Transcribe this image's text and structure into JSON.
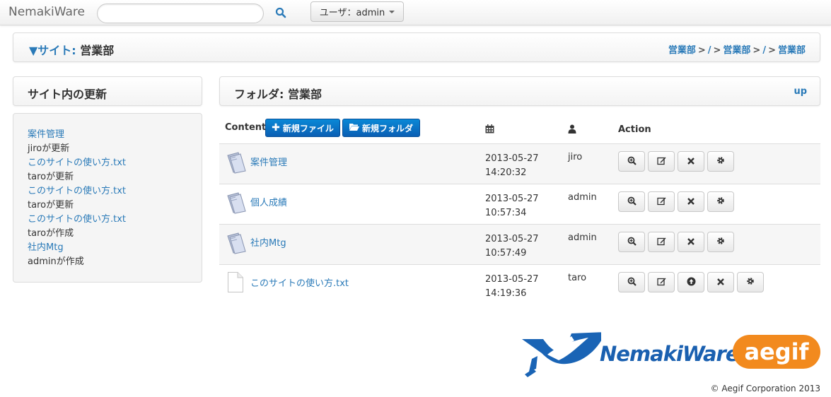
{
  "navbar": {
    "brand": "NemakiWare",
    "search_placeholder": "",
    "user_label": "ユーザ：admin"
  },
  "site": {
    "title_label": "▼サイト:",
    "title_name": "営業部",
    "breadcrumb": [
      "営業部",
      "/",
      "営業部",
      "/",
      "営業部"
    ]
  },
  "sidebar": {
    "title": "サイト内の更新",
    "updates": [
      {
        "text": "案件管理",
        "link": true
      },
      {
        "text": "jiroが更新",
        "link": false
      },
      {
        "text": "このサイトの使い方.txt",
        "link": true
      },
      {
        "text": "taroが更新",
        "link": false
      },
      {
        "text": "このサイトの使い方.txt",
        "link": true
      },
      {
        "text": "taroが更新",
        "link": false
      },
      {
        "text": "このサイトの使い方.txt",
        "link": true
      },
      {
        "text": "taroが作成",
        "link": false
      },
      {
        "text": "社内Mtg",
        "link": true
      },
      {
        "text": "adminが作成",
        "link": false
      }
    ]
  },
  "folder": {
    "title": "フォルダ: 営業部",
    "up_label": "up",
    "content_label": "Content",
    "new_file_label": "新規ファイル",
    "new_folder_label": "新規フォルダ",
    "action_label": "Action",
    "rows": [
      {
        "name": "案件管理",
        "type": "folder",
        "date": "2013-05-27",
        "time": "14:20:32",
        "user": "jiro",
        "actions": [
          "zoom-icon",
          "edit-icon",
          "delete-icon",
          "settings-icon"
        ]
      },
      {
        "name": "個人成績",
        "type": "folder",
        "date": "2013-05-27",
        "time": "10:57:34",
        "user": "admin",
        "actions": [
          "zoom-icon",
          "edit-icon",
          "delete-icon",
          "settings-icon"
        ]
      },
      {
        "name": "社内Mtg",
        "type": "folder",
        "date": "2013-05-27",
        "time": "10:57:49",
        "user": "admin",
        "actions": [
          "zoom-icon",
          "edit-icon",
          "delete-icon",
          "settings-icon"
        ]
      },
      {
        "name": "このサイトの使い方.txt",
        "type": "file",
        "date": "2013-05-27",
        "time": "14:19:36",
        "user": "taro",
        "actions": [
          "zoom-icon",
          "edit-icon",
          "upload-icon",
          "delete-icon",
          "settings-icon"
        ]
      }
    ]
  },
  "footer": {
    "logo_text": "NemakiWare",
    "aegif_text": "aegif",
    "copyright": "© Aegif Corporation 2013"
  }
}
